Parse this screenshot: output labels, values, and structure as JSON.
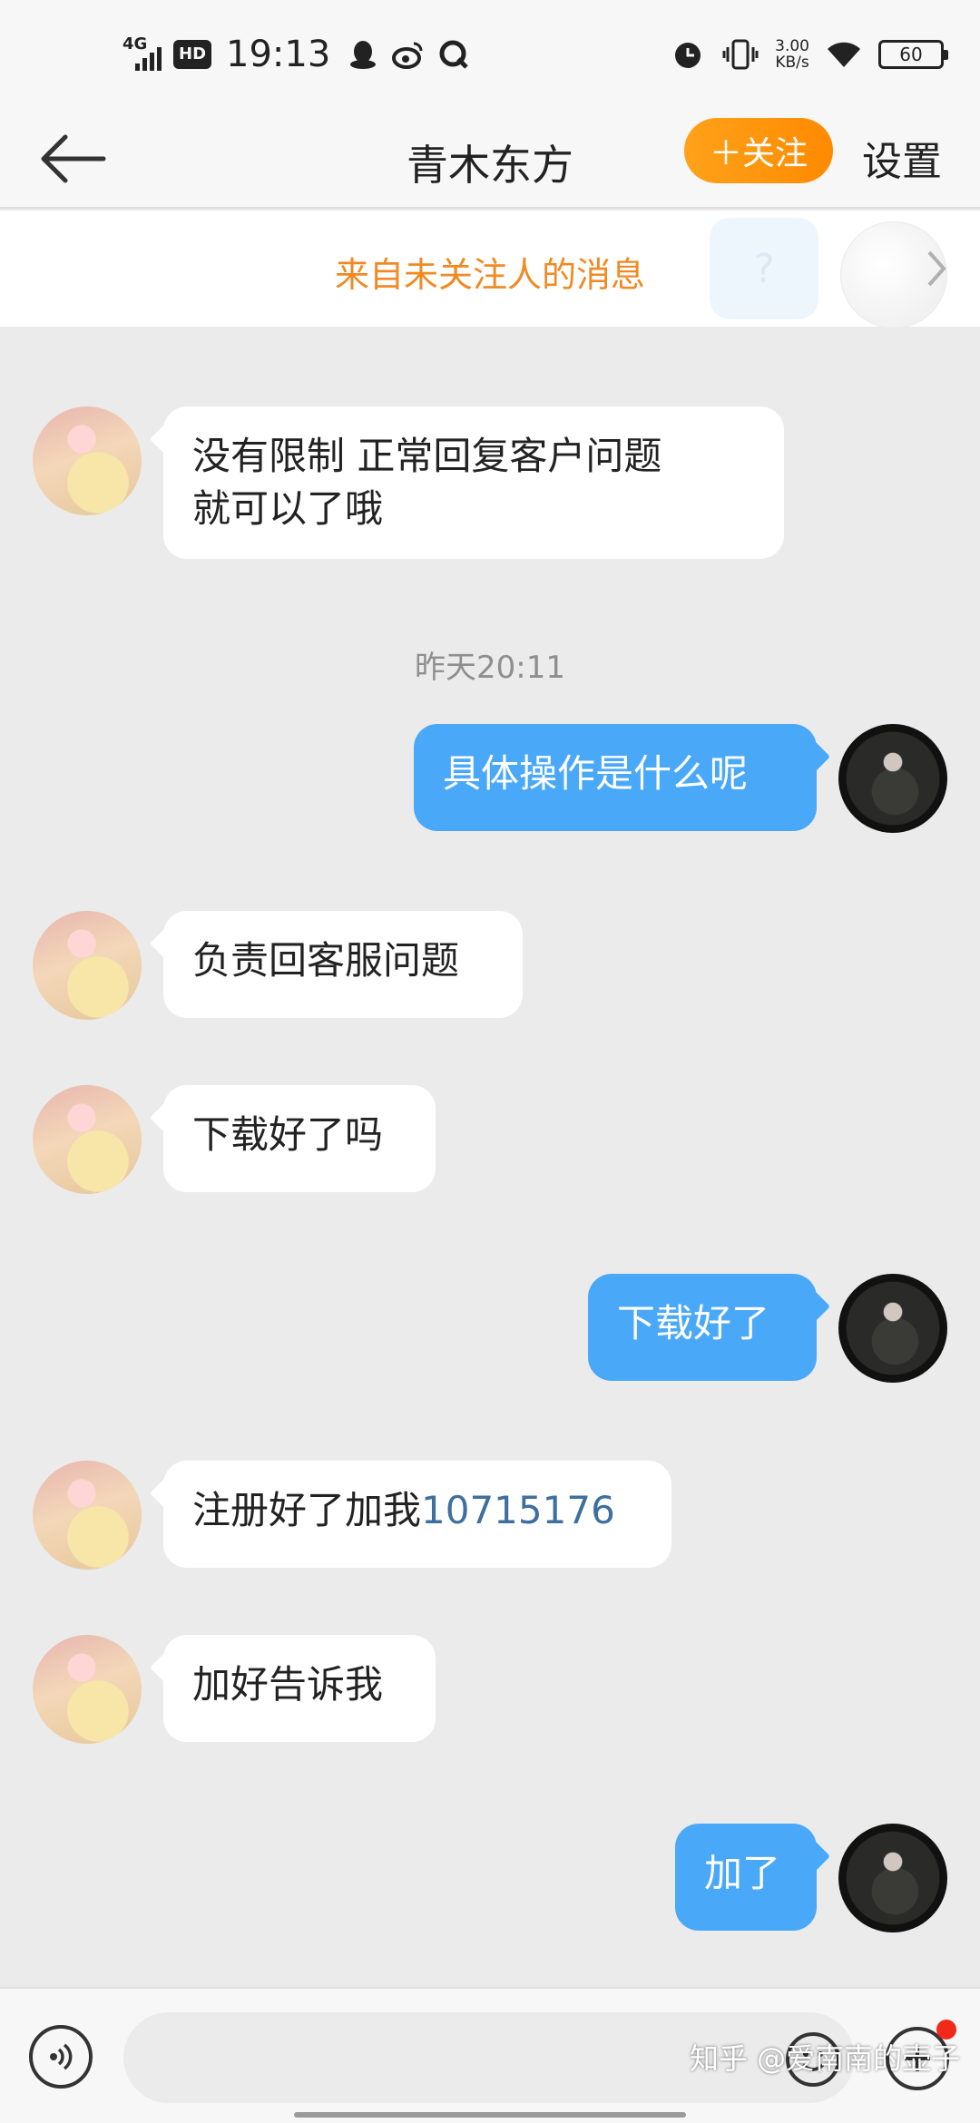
{
  "status_bar": {
    "network": "4G",
    "hd": "HD",
    "time": "19:13",
    "speed_value": "3.00",
    "speed_unit": "KB/s",
    "battery": "60",
    "icons": [
      "qq-icon",
      "weibo-icon",
      "q-app-icon",
      "alarm-icon",
      "vibrate-icon",
      "wifi-icon"
    ]
  },
  "header": {
    "title": "青木东方",
    "follow_label": "＋关注",
    "settings_label": "设置"
  },
  "banner": {
    "text": "来自未关注人的消息",
    "bubble_glyph": "?"
  },
  "messages": [
    {
      "from": "other",
      "lines": [
        "没有限制 正常回复客户问题",
        "就可以了哦"
      ]
    },
    {
      "type": "timestamp",
      "text": "昨天20:11"
    },
    {
      "from": "me",
      "text": "具体操作是什么呢"
    },
    {
      "from": "other",
      "text": "负责回客服问题"
    },
    {
      "from": "other",
      "text": "下载好了吗"
    },
    {
      "from": "me",
      "text": "下载好了"
    },
    {
      "from": "other",
      "text": "注册好了加我",
      "number": "10715176"
    },
    {
      "from": "other",
      "text": "加好告诉我"
    },
    {
      "from": "me",
      "text": "加了"
    }
  ],
  "input": {
    "placeholder": "",
    "watermark": "知乎 @爱南南的壶子"
  },
  "colors": {
    "accent_orange": "#ff8a00",
    "outgoing_bubble": "#4aa8f8",
    "incoming_bubble": "#ffffff",
    "background": "#ebebeb",
    "link_number": "#3f6f9f",
    "notice_dot": "#f1291b"
  }
}
